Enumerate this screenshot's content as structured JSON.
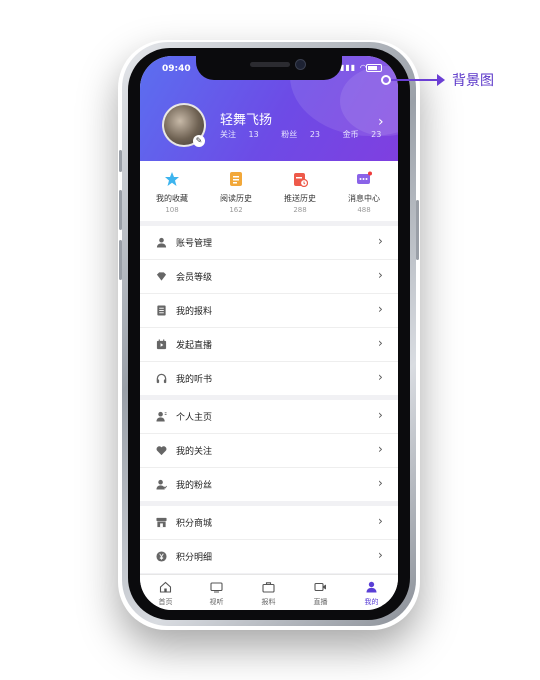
{
  "status": {
    "time": "09:40"
  },
  "profile": {
    "name": "轻舞飞扬",
    "stats": [
      {
        "label": "关注",
        "value": "13"
      },
      {
        "label": "粉丝",
        "value": "23"
      },
      {
        "label": "金币",
        "value": "23"
      }
    ]
  },
  "quick_actions": [
    {
      "label": "我的收藏",
      "count": "108",
      "icon": "star-icon",
      "color": "#3db4ee"
    },
    {
      "label": "阅读历史",
      "count": "162",
      "icon": "document-icon",
      "color": "#f2a83a"
    },
    {
      "label": "推送历史",
      "count": "288",
      "icon": "calendar-icon",
      "color": "#ee5a4a"
    },
    {
      "label": "消息中心",
      "count": "488",
      "icon": "message-icon",
      "color": "#8a63e8"
    }
  ],
  "menu_groups": [
    [
      {
        "label": "账号管理",
        "icon": "user-icon"
      },
      {
        "label": "会员等级",
        "icon": "diamond-icon"
      },
      {
        "label": "我的报料",
        "icon": "list-icon"
      },
      {
        "label": "发起直播",
        "icon": "live-icon"
      },
      {
        "label": "我的听书",
        "icon": "headphones-icon"
      }
    ],
    [
      {
        "label": "个人主页",
        "icon": "profile-icon"
      },
      {
        "label": "我的关注",
        "icon": "heart-icon"
      },
      {
        "label": "我的粉丝",
        "icon": "fans-icon"
      }
    ],
    [
      {
        "label": "积分商城",
        "icon": "shop-icon"
      },
      {
        "label": "积分明细",
        "icon": "yen-icon"
      }
    ]
  ],
  "tabs": [
    {
      "label": "首页",
      "icon": "home-icon",
      "active": false
    },
    {
      "label": "视听",
      "icon": "tv-icon",
      "active": false
    },
    {
      "label": "报料",
      "icon": "briefcase-icon",
      "active": false
    },
    {
      "label": "直播",
      "icon": "camera-icon",
      "active": false
    },
    {
      "label": "我的",
      "icon": "person-icon",
      "active": true
    }
  ],
  "annotation": {
    "label": "背景图"
  },
  "colors": {
    "accent": "#6d4be6",
    "callout": "#5a35c8"
  }
}
